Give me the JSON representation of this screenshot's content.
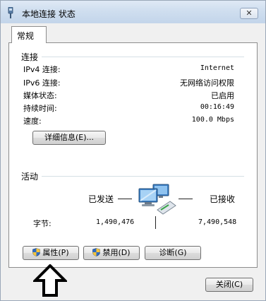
{
  "window": {
    "title": "本地连接 状态",
    "close_glyph": "✕"
  },
  "tabs": [
    {
      "label": "常规"
    }
  ],
  "connection": {
    "section_label": "连接",
    "rows": [
      {
        "label": "IPv4 连接:",
        "value": "Internet"
      },
      {
        "label": "IPv6 连接:",
        "value": "无网络访问权限"
      },
      {
        "label": "媒体状态:",
        "value": "已启用"
      },
      {
        "label": "持续时间:",
        "value": "00:16:49"
      },
      {
        "label": "速度:",
        "value": "100.0 Mbps"
      }
    ],
    "details_button": "详细信息(E)..."
  },
  "activity": {
    "section_label": "活动",
    "sent_label": "已发送",
    "received_label": "已接收",
    "bytes_label": "字节:",
    "bytes_sent": "1,490,476",
    "bytes_received": "7,490,548",
    "icon": "network-computers-icon"
  },
  "buttons": {
    "properties": "属性(P)",
    "disable": "禁用(D)",
    "diagnose": "诊断(G)",
    "close": "关闭(C)"
  },
  "annotation": {
    "icon": "up-arrow-outline-icon"
  },
  "colors": {
    "titlebar": "#cfdeef",
    "panel": "#ffffff",
    "window_bg": "#f0f0f0",
    "rule": "#d5dfe5"
  }
}
